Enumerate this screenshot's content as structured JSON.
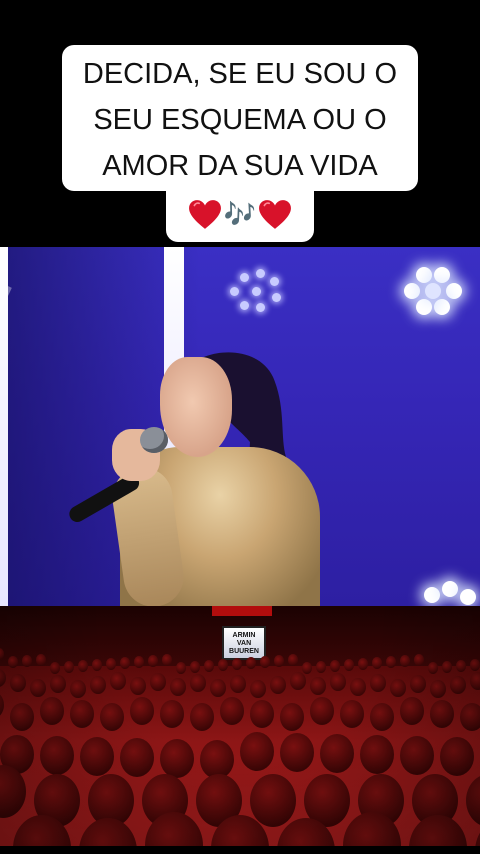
{
  "caption": {
    "line1": "DECIDA, SE EU SOU O",
    "line2": "SEU  ESQUEMA OU O",
    "line3": "AMOR DA SUA VIDA",
    "emoji_notes": "🎶",
    "heart_color": "#d8122a"
  },
  "crowd_scene": {
    "screen_text_line1": "ARMIN",
    "screen_text_line2": "VAN BUUREN"
  },
  "colors": {
    "stage_blue": "#3526b6",
    "crowd_red": "#a31c1c"
  }
}
